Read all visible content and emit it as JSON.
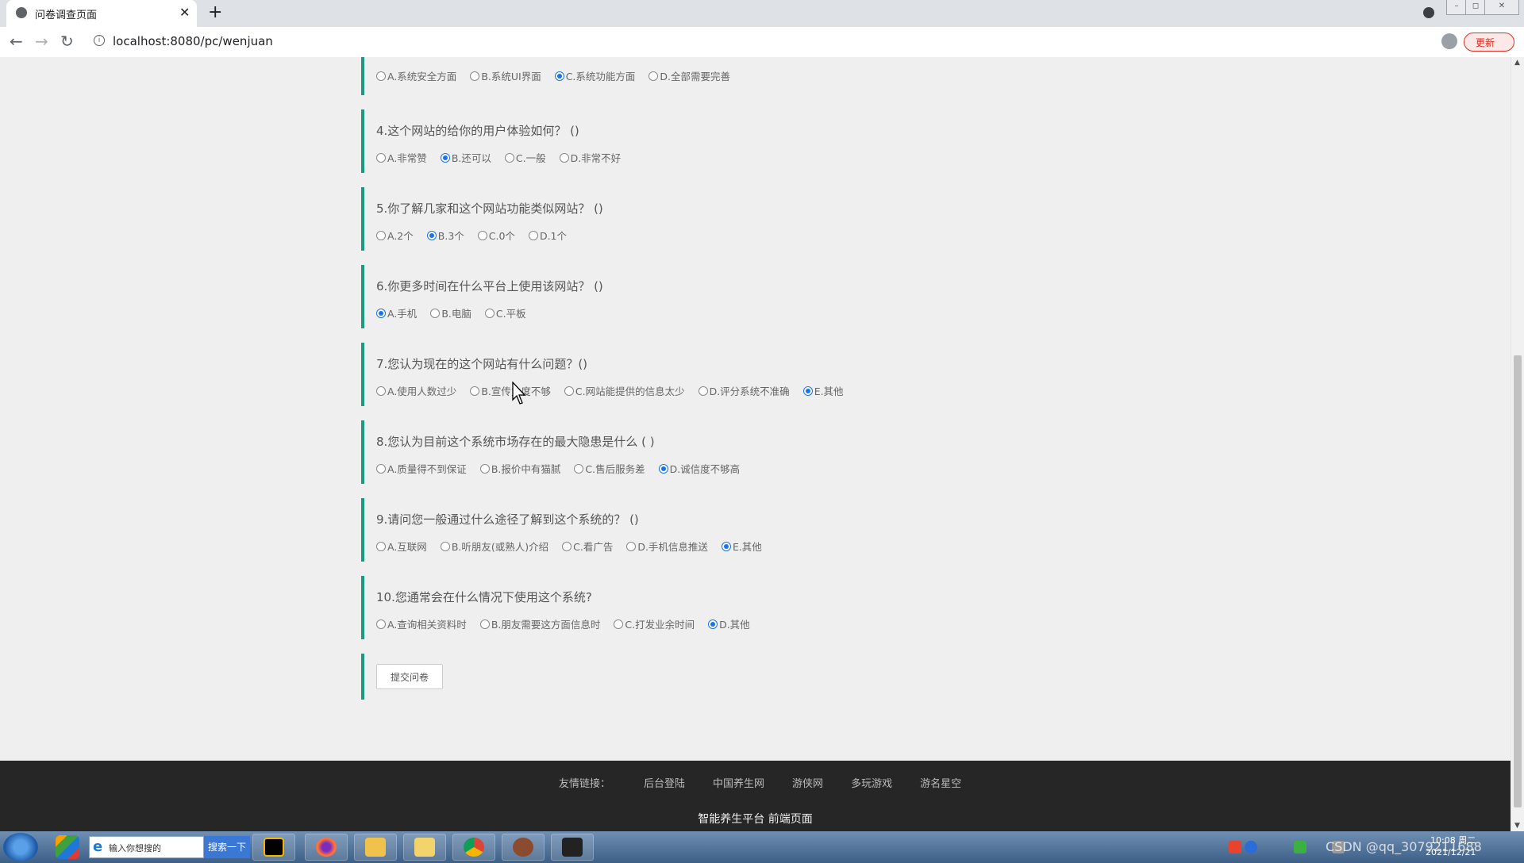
{
  "browser": {
    "tab_title": "问卷调查页面",
    "tab_close": "✕",
    "new_tab": "+",
    "url": "localhost:8080/pc/wenjuan",
    "update_label": "更新"
  },
  "survey": {
    "partial_question": {
      "options": [
        {
          "label": "A.系统安全方面",
          "checked": false
        },
        {
          "label": "B.系统UI界面",
          "checked": false
        },
        {
          "label": "C.系统功能方面",
          "checked": true
        },
        {
          "label": "D.全部需要完善",
          "checked": false
        }
      ]
    },
    "questions": [
      {
        "title": "4.这个网站的给你的用户体验如何？ ()",
        "options": [
          {
            "label": "A.非常赞",
            "checked": false
          },
          {
            "label": "B.还可以",
            "checked": true
          },
          {
            "label": "C.一般",
            "checked": false
          },
          {
            "label": "D.非常不好",
            "checked": false
          }
        ]
      },
      {
        "title": "5.你了解几家和这个网站功能类似网站？ ()",
        "options": [
          {
            "label": "A.2个",
            "checked": false
          },
          {
            "label": "B.3个",
            "checked": true
          },
          {
            "label": "C.0个",
            "checked": false
          },
          {
            "label": "D.1个",
            "checked": false
          }
        ]
      },
      {
        "title": "6.你更多时间在什么平台上使用该网站？ ()",
        "options": [
          {
            "label": "A.手机",
            "checked": true
          },
          {
            "label": "B.电脑",
            "checked": false
          },
          {
            "label": "C.平板",
            "checked": false
          }
        ]
      },
      {
        "title": "7.您认为现在的这个网站有什么问题？()",
        "options": [
          {
            "label": "A.使用人数过少",
            "checked": false
          },
          {
            "label": "B.宣传力度不够",
            "checked": false
          },
          {
            "label": "C.网站能提供的信息太少",
            "checked": false
          },
          {
            "label": "D.评分系统不准确",
            "checked": false
          },
          {
            "label": "E.其他",
            "checked": true
          }
        ]
      },
      {
        "title": "8.您认为目前这个系统市场存在的最大隐患是什么 ( )",
        "options": [
          {
            "label": "A.质量得不到保证",
            "checked": false
          },
          {
            "label": "B.报价中有猫腻",
            "checked": false
          },
          {
            "label": "C.售后服务差",
            "checked": false
          },
          {
            "label": "D.诚信度不够高",
            "checked": true
          }
        ]
      },
      {
        "title": "9.请问您一般通过什么途径了解到这个系统的？ ()",
        "options": [
          {
            "label": "A.互联网",
            "checked": false
          },
          {
            "label": "B.听朋友(或熟人)介绍",
            "checked": false
          },
          {
            "label": "C.看广告",
            "checked": false
          },
          {
            "label": "D.手机信息推送",
            "checked": false
          },
          {
            "label": "E.其他",
            "checked": true
          }
        ]
      },
      {
        "title": "10.您通常会在什么情况下使用这个系统?",
        "options": [
          {
            "label": "A.查询相关资料时",
            "checked": false
          },
          {
            "label": "B.朋友需要这方面信息时",
            "checked": false
          },
          {
            "label": "C.打发业余时间",
            "checked": false
          },
          {
            "label": "D.其他",
            "checked": true
          }
        ]
      }
    ],
    "submit_label": "提交问卷"
  },
  "footer": {
    "links_label": "友情链接：",
    "links": [
      "后台登陆",
      "中国养生网",
      "游侠网",
      "多玩游戏",
      "游名星空"
    ],
    "title": "智能养生平台 前端页面"
  },
  "taskbar": {
    "search_placeholder": "输入你想搜的",
    "search_button": "搜索一下",
    "clock_time": "10:08 周二",
    "clock_date": "2021/12/21",
    "watermark": "CSDN @qq_3079211688"
  },
  "colors": {
    "accent_bar": "#1a9a82",
    "radio_checked": "#1a73e8",
    "footer_bg": "#262626",
    "update_button": "#d93025"
  }
}
